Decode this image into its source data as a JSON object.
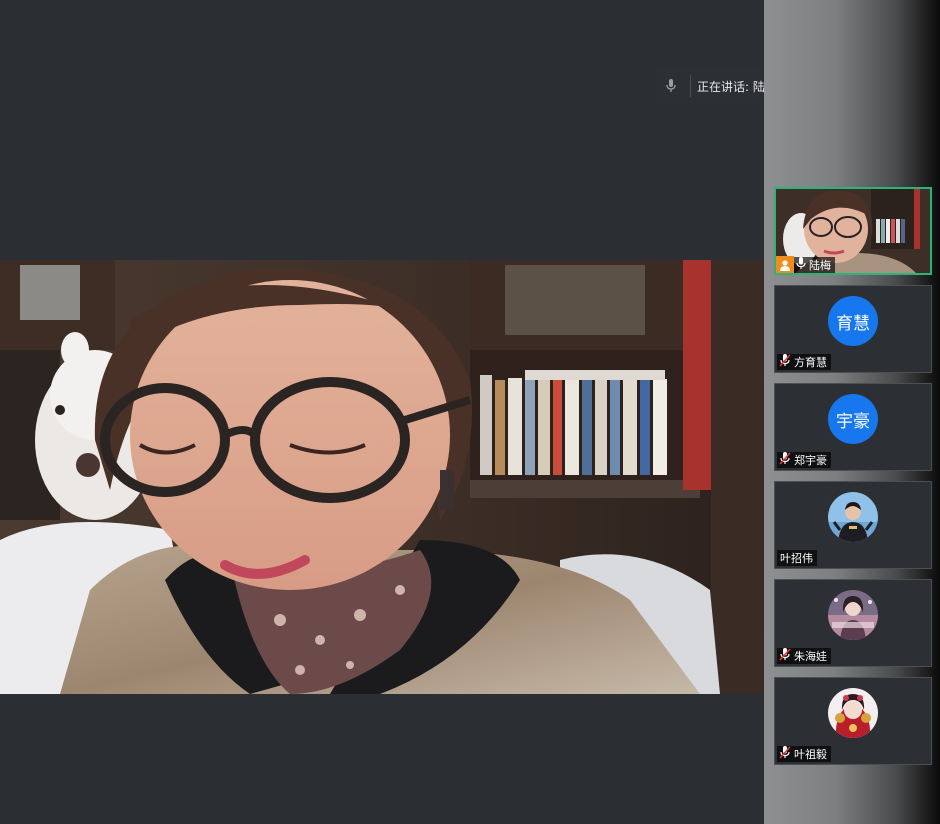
{
  "speaking": {
    "label": "正在讲话: 陆梅;"
  },
  "icons": {
    "mic": "microphone-icon",
    "mic_muted": "microphone-muted-icon",
    "host": "host-person-icon",
    "collapse": "collapse-arrows-icon",
    "back": "reply-arrow-icon"
  },
  "colors": {
    "active_border": "#2db37a",
    "avatar_blue": "#1677ee",
    "host_badge": "#f08c1e"
  },
  "participants": [
    {
      "name": "陆梅",
      "avatar_text": "",
      "active": true
    },
    {
      "name": "方育慧",
      "avatar_text": "育慧"
    },
    {
      "name": "郑宇豪",
      "avatar_text": "宇豪"
    },
    {
      "name": "叶招伟",
      "avatar_text": ""
    },
    {
      "name": "朱海娃",
      "avatar_text": ""
    },
    {
      "name": "叶祖毅",
      "avatar_text": ""
    }
  ]
}
